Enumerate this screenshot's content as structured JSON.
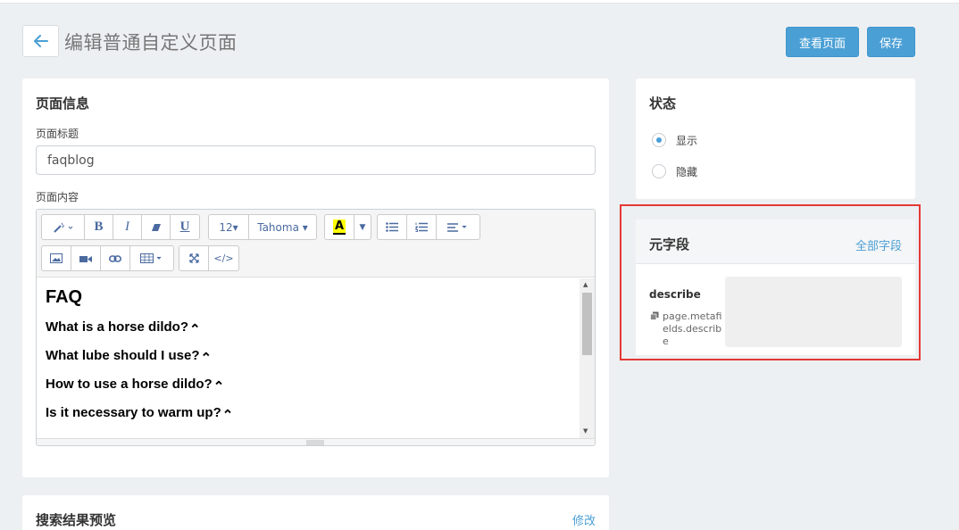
{
  "header": {
    "back_icon": "arrow-left-icon",
    "title": "编辑普通自定义页面",
    "view_page_label": "查看页面",
    "save_label": "保存",
    "accent_color": "#4a9fd5"
  },
  "page_info": {
    "title": "页面信息",
    "page_title_label": "页面标题",
    "page_title_value": "faqblog",
    "page_content_label": "页面内容",
    "toolbar": {
      "font_size": "12▾",
      "font_family": "Tahoma ▾"
    },
    "content": {
      "heading": "FAQ",
      "questions": [
        "What is a horse dildo?",
        "What lube should I use?",
        "How to use a horse dildo?",
        "Is it necessary to warm up?"
      ],
      "caret": "⌃"
    }
  },
  "seo": {
    "title": "搜索结果预览",
    "edit_label": "修改"
  },
  "status": {
    "title": "状态",
    "options": [
      {
        "label": "显示",
        "checked": true
      },
      {
        "label": "隐藏",
        "checked": false
      }
    ]
  },
  "metafields": {
    "title": "元字段",
    "all_fields_label": "全部字段",
    "field_name": "describe",
    "field_key": "page.metafields.describe",
    "field_key_lines": [
      "page.metafi",
      "elds.describ",
      "e"
    ]
  },
  "highlight_color": "#e53935"
}
